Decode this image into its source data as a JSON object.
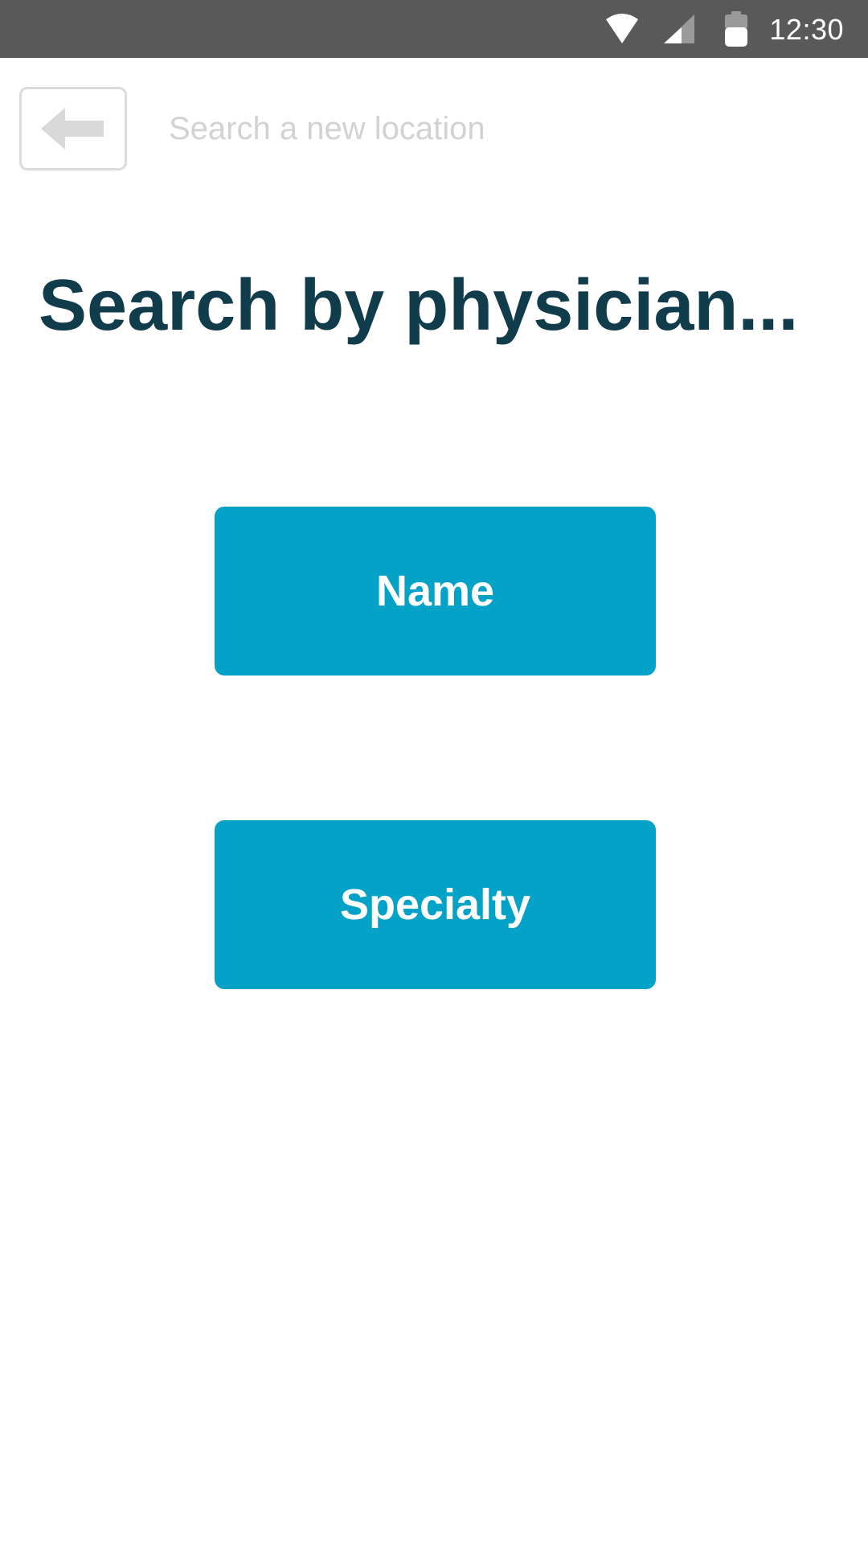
{
  "status_bar": {
    "time": "12:30",
    "icons": [
      "wifi-icon",
      "cell-signal-icon",
      "battery-icon"
    ],
    "background_color": "#595959"
  },
  "search": {
    "placeholder": "Search a new location",
    "value": ""
  },
  "back_button": {
    "icon": "back-arrow-icon"
  },
  "page": {
    "title": "Search by physician..."
  },
  "options": {
    "name_label": "Name",
    "specialty_label": "Specialty",
    "color": "#05a2c8"
  },
  "colors": {
    "title": "#113c4b",
    "placeholder": "#d2d2d2",
    "button_text": "#ffffff"
  }
}
